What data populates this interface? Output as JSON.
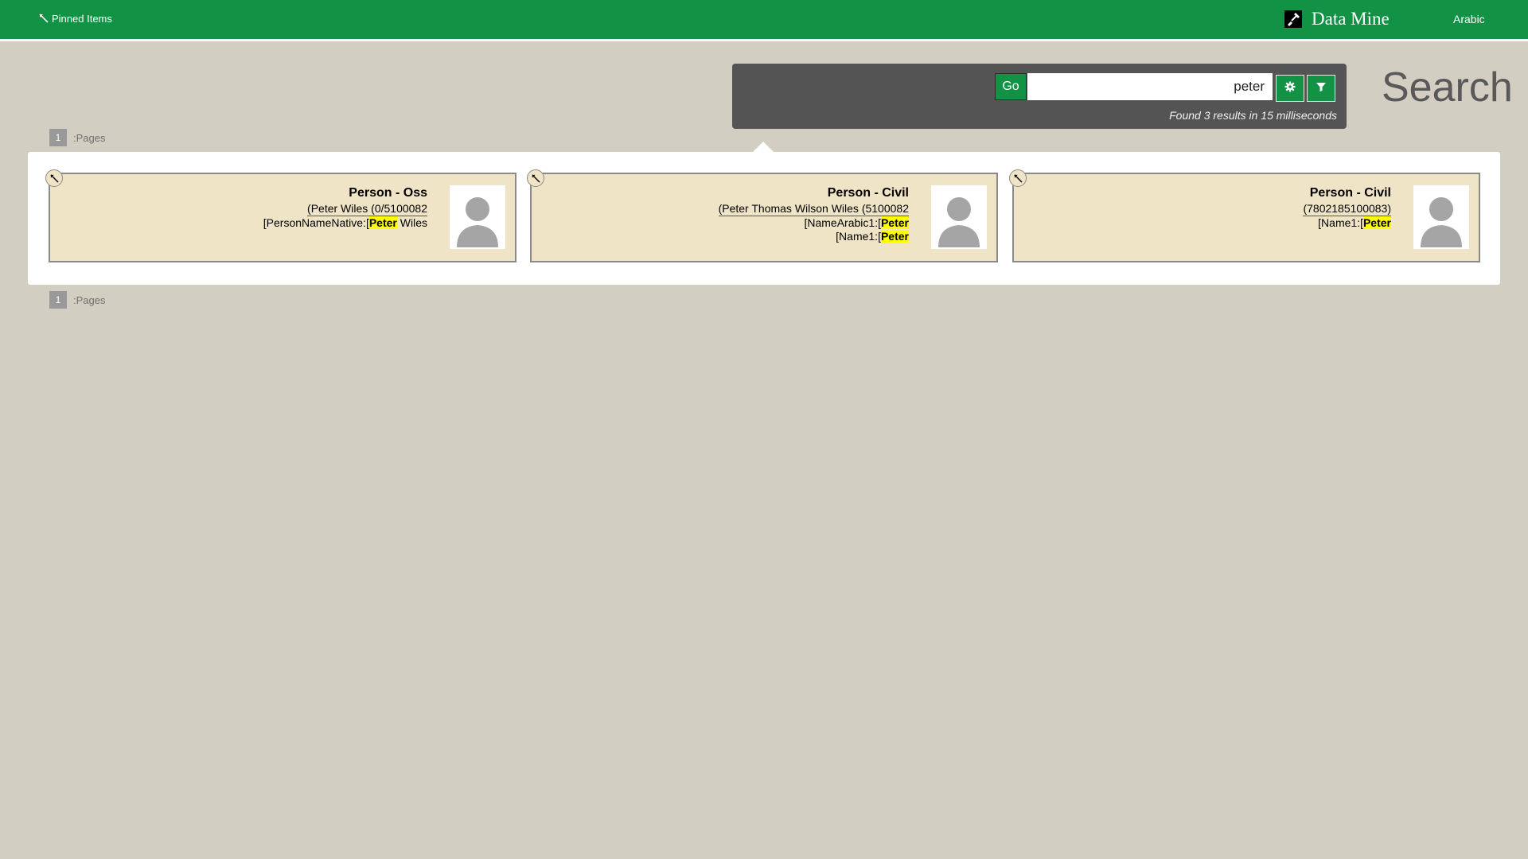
{
  "topbar": {
    "pinned_label": "Pinned Items",
    "brand_name": "Data Mine",
    "language_link": "Arabic"
  },
  "search": {
    "go_label": "Go",
    "query": "peter",
    "results_info": "Found 3 results in 15 milliseconds",
    "page_title": "Search"
  },
  "pagination": {
    "current_page": "1",
    "label": ":Pages"
  },
  "results": [
    {
      "title": "Person - Oss",
      "subtitle": "(Peter Wiles (0/5100082",
      "lines": [
        {
          "prefix": "[PersonNameNative:[",
          "highlight": "Peter",
          "suffix": " Wiles"
        }
      ]
    },
    {
      "title": "Person - Civil",
      "subtitle": "(Peter Thomas Wilson Wiles (5100082",
      "lines": [
        {
          "prefix": "[NameArabic1:[",
          "highlight": "Peter",
          "suffix": ""
        },
        {
          "prefix": "[Name1:[",
          "highlight": "Peter",
          "suffix": ""
        }
      ]
    },
    {
      "title": "Person - Civil",
      "subtitle": "(7802185100083)",
      "lines": [
        {
          "prefix": "[Name1:[",
          "highlight": "Peter",
          "suffix": ""
        }
      ]
    }
  ],
  "icons": {
    "pin": "pin-icon",
    "settings": "gear-icon",
    "filter": "filter-icon",
    "logo": "shovel-icon",
    "avatar": "person-silhouette-icon"
  },
  "colors": {
    "brand_green": "#119244",
    "background": "#d2cec1",
    "panel": "#545454",
    "card": "#f0e4c6",
    "highlight": "#ffff00"
  }
}
